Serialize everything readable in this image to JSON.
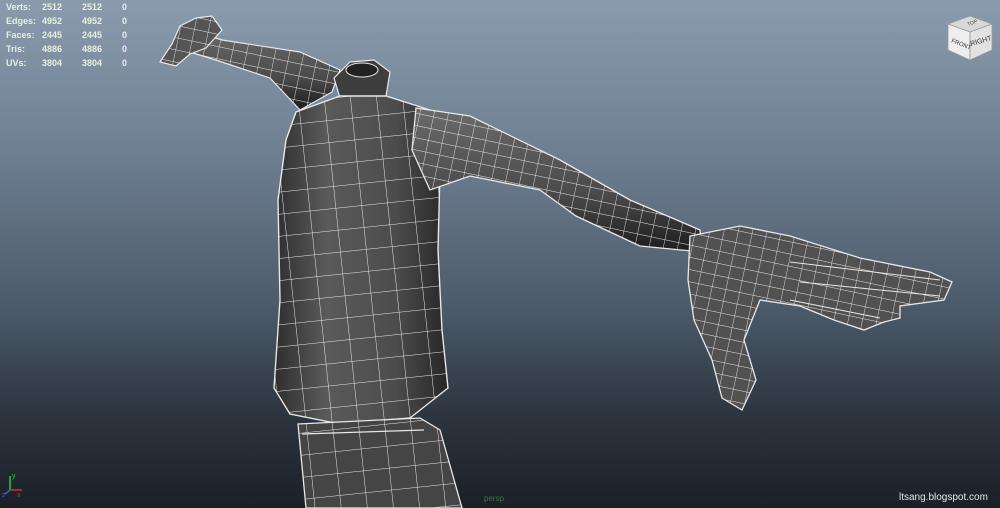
{
  "hud": {
    "rows": [
      {
        "label": "Verts:",
        "a": "2512",
        "b": "2512",
        "c": "0"
      },
      {
        "label": "Edges:",
        "a": "4952",
        "b": "4952",
        "c": "0"
      },
      {
        "label": "Faces:",
        "a": "2445",
        "b": "2445",
        "c": "0"
      },
      {
        "label": "Tris:",
        "a": "4886",
        "b": "4886",
        "c": "0"
      },
      {
        "label": "UVs:",
        "a": "3804",
        "b": "3804",
        "c": "0"
      }
    ]
  },
  "viewcube": {
    "left_face": "FRONT",
    "right_face": "RIGHT",
    "top_face": "TOP"
  },
  "axis": {
    "x": "x",
    "y": "y",
    "z": "z"
  },
  "camera_label": "persp",
  "watermark": "ltsang.blogspot.com",
  "colors": {
    "mesh_fill": "#4a4a4a",
    "wire": "#e8e8e8",
    "hud_text": "#e8f0e0"
  }
}
